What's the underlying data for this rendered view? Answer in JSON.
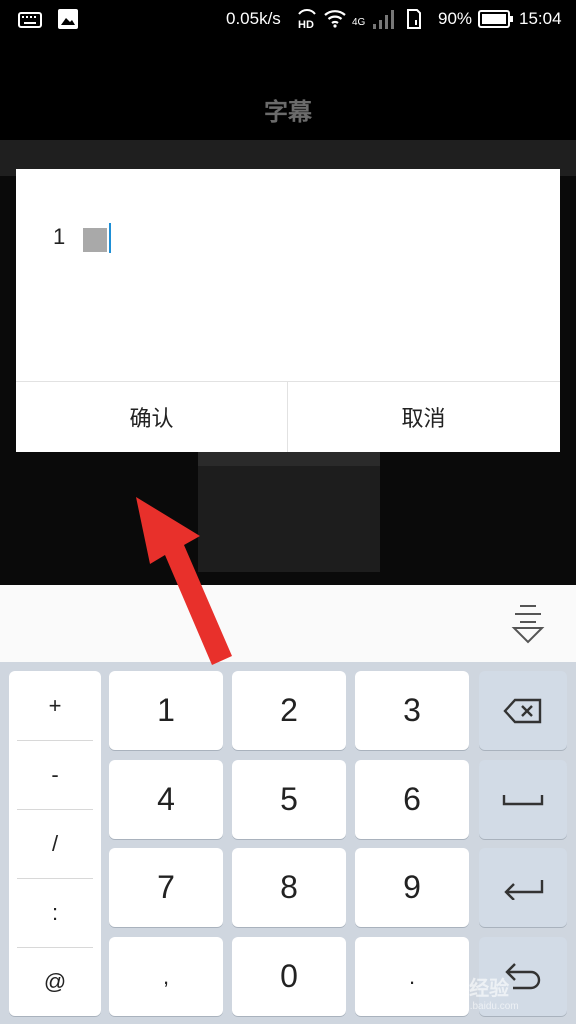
{
  "status_bar": {
    "speed": "0.05k/s",
    "battery": "90%",
    "time": "15:04",
    "icons": [
      "keyboard-icon",
      "image-icon",
      "hd-icon",
      "wifi-icon",
      "4g-icon",
      "signal-icon",
      "sim-icon",
      "battery-icon"
    ]
  },
  "header": {
    "title": "字幕"
  },
  "dialog": {
    "input_value": "1",
    "confirm_label": "确认",
    "cancel_label": "取消"
  },
  "keyboard": {
    "symbols": [
      "+",
      "-",
      "/",
      ":",
      "@"
    ],
    "digits": [
      "1",
      "2",
      "3",
      "4",
      "5",
      "6",
      "7",
      "8",
      "9",
      ",",
      "0",
      "."
    ],
    "function_keys": [
      "backspace-icon",
      "space-icon",
      "enter-icon",
      "return-icon"
    ],
    "toolbar_icon": "keyboard-hide-icon"
  },
  "annotation": {
    "arrow_color": "#e8302b",
    "icon": "red-arrow"
  },
  "watermark": {
    "line1": "Bai经验",
    "line2": "jingyan.baidu.com"
  },
  "colors": {
    "caret": "#1e8fd6",
    "keyboard_bg": "#cfd6df",
    "func_key": "#d2dbe6"
  }
}
